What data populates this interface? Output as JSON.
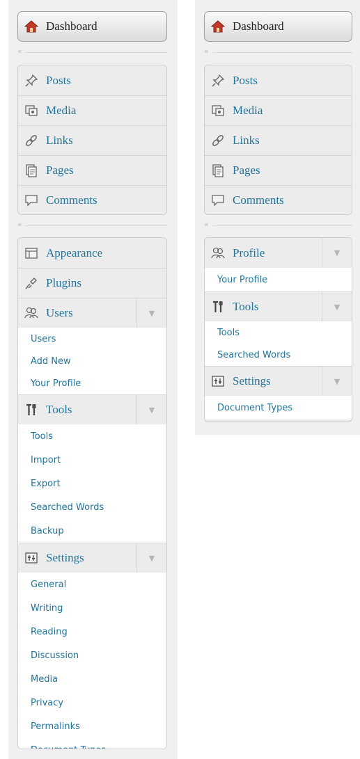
{
  "left": {
    "dashboard": "Dashboard",
    "group1": [
      "Posts",
      "Media",
      "Links",
      "Pages",
      "Comments"
    ],
    "appearance": "Appearance",
    "plugins": "Plugins",
    "users": {
      "label": "Users",
      "submenu": [
        "Users",
        "Add New",
        "Your Profile"
      ]
    },
    "tools": {
      "label": "Tools",
      "submenu": [
        "Tools",
        "Import",
        "Export",
        "Searched Words",
        "Backup"
      ]
    },
    "settings": {
      "label": "Settings",
      "submenu": [
        "General",
        "Writing",
        "Reading",
        "Discussion",
        "Media",
        "Privacy",
        "Permalinks",
        "Document Types"
      ]
    }
  },
  "right": {
    "dashboard": "Dashboard",
    "group1": [
      "Posts",
      "Media",
      "Links",
      "Pages",
      "Comments"
    ],
    "profile": {
      "label": "Profile",
      "submenu": [
        "Your Profile"
      ]
    },
    "tools": {
      "label": "Tools",
      "submenu": [
        "Tools",
        "Searched Words"
      ]
    },
    "settings": {
      "label": "Settings",
      "submenu": [
        "Document Types"
      ]
    }
  },
  "icons": {
    "dashboard": "home-icon",
    "posts": "pushpin-icon",
    "media": "media-icon",
    "links": "link-icon",
    "pages": "pages-icon",
    "comments": "comment-icon",
    "appearance": "appearance-icon",
    "plugins": "plugin-icon",
    "users": "users-icon",
    "tools": "tools-icon",
    "settings": "settings-icon",
    "collapse": "collapse-arrow-icon",
    "toggle": "triangle-down-icon"
  },
  "colors": {
    "link": "#21759b",
    "sidebar_bg": "#f0f0f0",
    "header_bg": "#ececec",
    "home_roof": "#c0392b"
  }
}
